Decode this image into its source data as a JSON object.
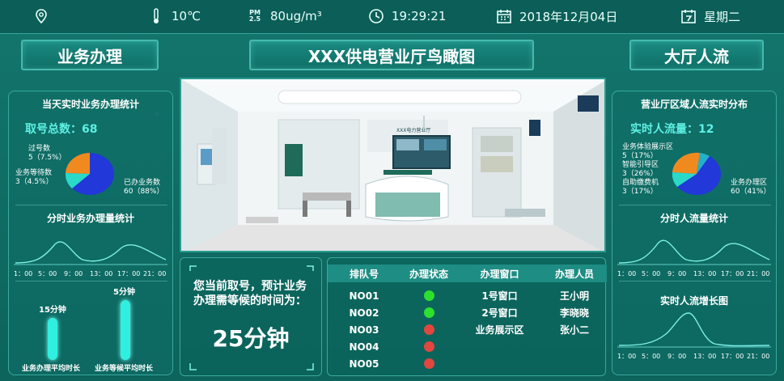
{
  "topbar": {
    "temperature": "10℃",
    "pm_label_top": "PM",
    "pm_label_bottom": "2.5",
    "pm": "80ug/m³",
    "time": "19:29:21",
    "date": "2018年12月04日",
    "weekday": "星期二"
  },
  "titles": {
    "left": "业务办理",
    "center": "XXX供电营业厅鸟瞰图",
    "right": "大厅人流"
  },
  "left": {
    "pie_title": "当天实时业务办理统计",
    "total_label": "取号总数：",
    "total": "68",
    "slices": [
      {
        "name": "已办业务数",
        "value": "60（88%）",
        "color": "#2238d8"
      },
      {
        "name": "过号数",
        "value": "5（7.5%）",
        "color": "#f08a1e"
      },
      {
        "name": "业务等待数",
        "value": "3（4.5%）",
        "color": "#2ad9c8"
      }
    ],
    "line_title": "分时业务办理量统计",
    "x_ticks": [
      "1：00",
      "5：00",
      "9：00",
      "13：00",
      "17：00",
      "21：00"
    ],
    "bars": [
      {
        "value_label": "15分钟",
        "label": "业务办理平均时长",
        "value": 15
      },
      {
        "value_label": "5分钟",
        "label": "业务等候平均时长",
        "value": 5
      }
    ]
  },
  "photo": {
    "sign": "XXX电力营业厅"
  },
  "wait": {
    "text": "您当前取号，预计业务办理需等候的时间为：",
    "time": "25分钟"
  },
  "queue": {
    "headers": [
      "排队号",
      "办理状态",
      "办理窗口",
      "办理人员"
    ],
    "rows": [
      {
        "no": "NO01",
        "status": "green",
        "window": "1号窗口",
        "staff": "王小明"
      },
      {
        "no": "NO02",
        "status": "green",
        "window": "2号窗口",
        "staff": "李晓晓"
      },
      {
        "no": "NO03",
        "status": "red",
        "window": "业务展示区",
        "staff": "张小二"
      },
      {
        "no": "NO04",
        "status": "red",
        "window": "",
        "staff": ""
      },
      {
        "no": "NO05",
        "status": "red",
        "window": "",
        "staff": ""
      }
    ]
  },
  "right": {
    "pie_title": "营业厅区域人流实时分布",
    "total_label": "实时人流量：",
    "total": "12",
    "slices": [
      {
        "name": "业务办理区",
        "value": "60（41%）",
        "color": "#2238d8"
      },
      {
        "name": "业务体验展示区",
        "value": "5（17%）",
        "color": "#f08a1e"
      },
      {
        "name": "智能引导区",
        "value": "3（26%）",
        "color": "#2ad9c8"
      },
      {
        "name": "自助缴费机",
        "value": "3（17%）",
        "color": "#23b0c8"
      }
    ],
    "line_title": "分时人流量统计",
    "growth_title": "实时人流增长图",
    "x_ticks": [
      "1：00",
      "5：00",
      "9：00",
      "13：00",
      "17：00",
      "21：00"
    ]
  },
  "colors": {
    "green": "#2ee02e",
    "red": "#e0473f",
    "accent": "#5ff0e4"
  }
}
